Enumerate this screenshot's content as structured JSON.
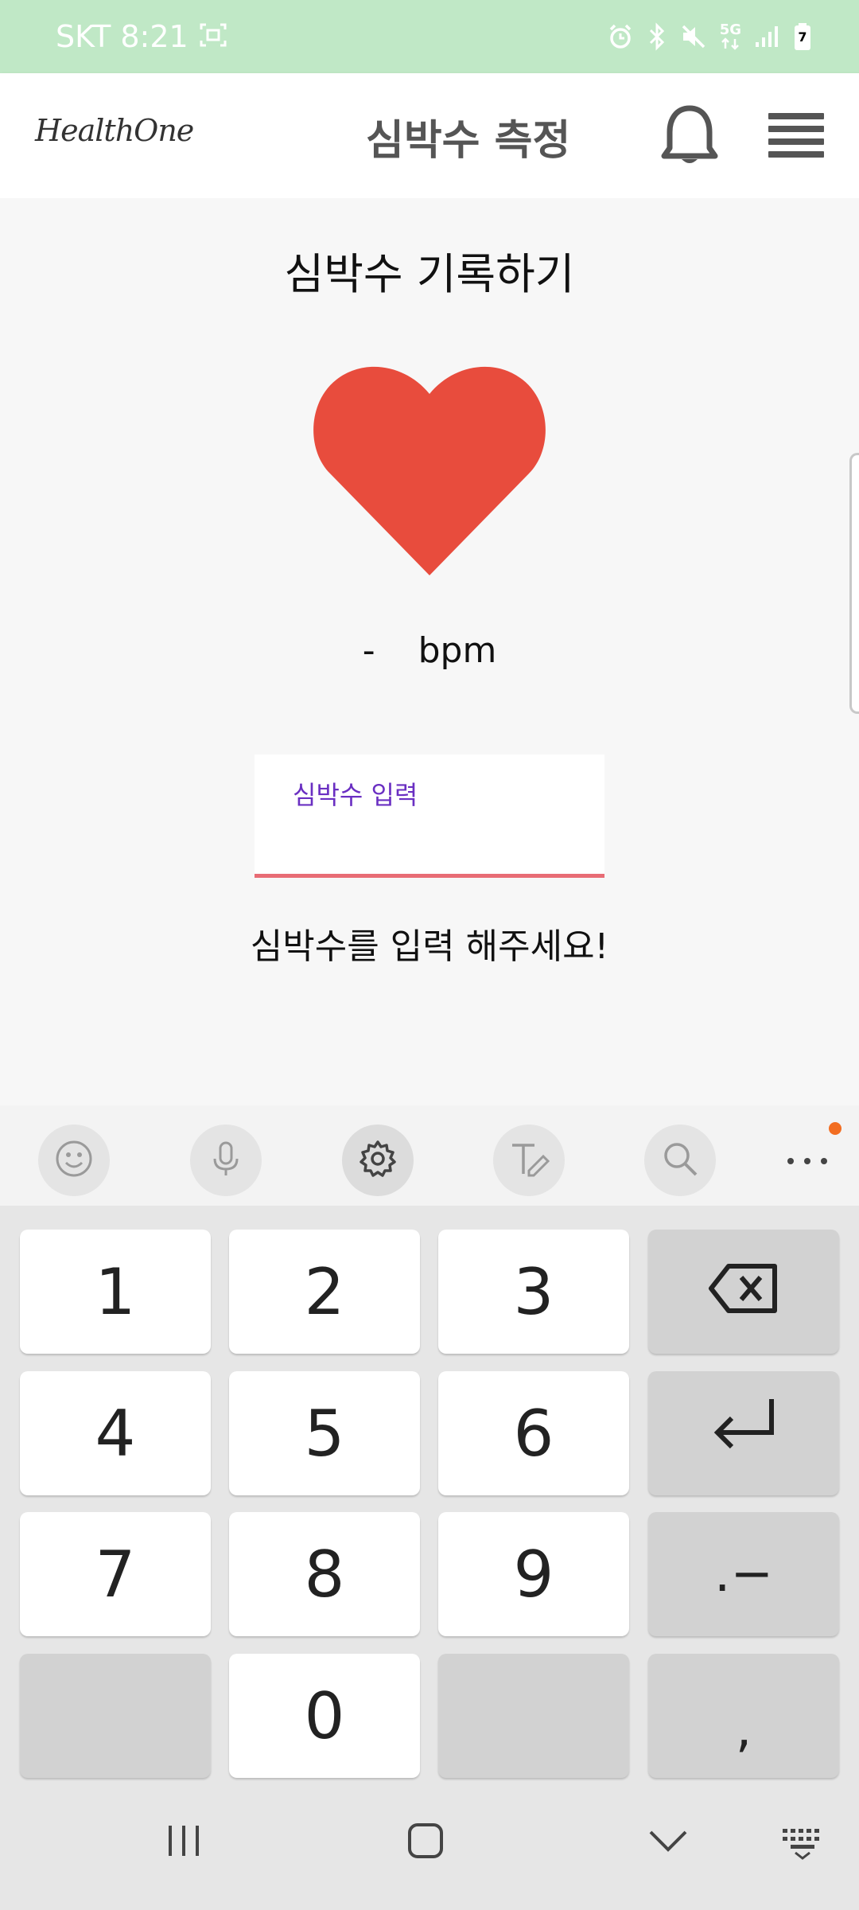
{
  "status_bar": {
    "carrier_time": "SKT 8:21",
    "network_badge": "5G",
    "battery_level": "7",
    "color": "#c0e8c6"
  },
  "app_bar": {
    "logo": "HealthOne",
    "title": "심박수 측정",
    "icons": [
      "bell-icon",
      "menu-icon"
    ]
  },
  "content": {
    "heading": "심박수 기록하기",
    "heart_color": "#e84c3d",
    "bpm_value": "-",
    "bpm_unit": "bpm",
    "input_label": "심박수 입력",
    "input_value": "",
    "helper_text": "심박수를 입력 해주세요!",
    "error_color": "#e86c75"
  },
  "keyboard_toolbar": {
    "tools": [
      "emoji-icon",
      "microphone-icon",
      "settings-icon",
      "handwriting-icon",
      "search-icon",
      "more-icon"
    ]
  },
  "keypad": {
    "keys": [
      "1",
      "2",
      "3",
      "4",
      "5",
      "6",
      "7",
      "8",
      "9",
      "0"
    ],
    "symbol_key": ".−",
    "comma_key": ","
  },
  "nav_bar": {
    "items": [
      "recent-apps-icon",
      "home-icon",
      "back-icon",
      "keyboard-icon"
    ]
  }
}
